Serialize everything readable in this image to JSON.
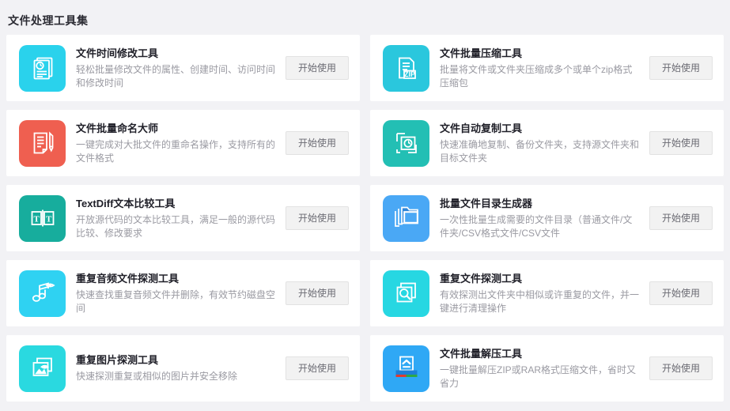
{
  "section": {
    "title": "文件处理工具集"
  },
  "button_label": "开始使用",
  "colors": {
    "page_background": "#f2f2f5",
    "card_background": "#ffffff",
    "title_color": "#2b2b33",
    "desc_color": "#9a9aa2",
    "button_background": "#f2f2f2"
  },
  "tools": [
    {
      "title": "文件时间修改工具",
      "desc": "轻松批量修改文件的属性、创建时间、访问时间和修改时间",
      "button": "开始使用",
      "icon": "document-clock-icon",
      "icon_color": "#2ad2ec"
    },
    {
      "title": "文件批量压缩工具",
      "desc": "批量将文件或文件夹压缩成多个或单个zip格式压缩包",
      "button": "开始使用",
      "icon": "zip-file-icon",
      "icon_color": "#2ac7dd"
    },
    {
      "title": "文件批量命名大师",
      "desc": "一键完成对大批文件的重命名操作，支持所有的文件格式",
      "button": "开始使用",
      "icon": "document-pencil-icon",
      "icon_color": "#ef5f50"
    },
    {
      "title": "文件自动复制工具",
      "desc": "快速准确地复制、备份文件夹，支持源文件夹和目标文件夹",
      "button": "开始使用",
      "icon": "copy-clock-icon",
      "icon_color": "#23bfb4"
    },
    {
      "title": "TextDiff文本比较工具",
      "desc": "开放源代码的文本比较工具，满足一般的源代码比较、修改要求",
      "button": "开始使用",
      "icon": "text-compare-icon",
      "icon_color": "#17ad9d"
    },
    {
      "title": "批量文件目录生成器",
      "desc": "一次性批量生成需要的文件目录（普通文件/文件夹/CSV格式文件/CSV文件",
      "button": "开始使用",
      "icon": "folder-stack-icon",
      "icon_color": "#4aa8f5"
    },
    {
      "title": "重复音频文件探测工具",
      "desc": "快速查找重复音频文件并删除，有效节约磁盘空间",
      "button": "开始使用",
      "icon": "audio-note-eye-icon",
      "icon_color": "#2fd2f2"
    },
    {
      "title": "重复文件探测工具",
      "desc": "有效探测出文件夹中相似或许重复的文件，并一键进行清理操作",
      "button": "开始使用",
      "icon": "file-search-icon",
      "icon_color": "#27d7e2"
    },
    {
      "title": "重复图片探测工具",
      "desc": "快速探测重复或相似的图片并安全移除",
      "button": "开始使用",
      "icon": "image-eye-icon",
      "icon_color": "#2ad9e0"
    },
    {
      "title": "文件批量解压工具",
      "desc": "一键批量解压ZIP或RAR格式压缩文件，省时又省力",
      "button": "开始使用",
      "icon": "unzip-icon",
      "icon_color": "#2fa8f5"
    }
  ]
}
